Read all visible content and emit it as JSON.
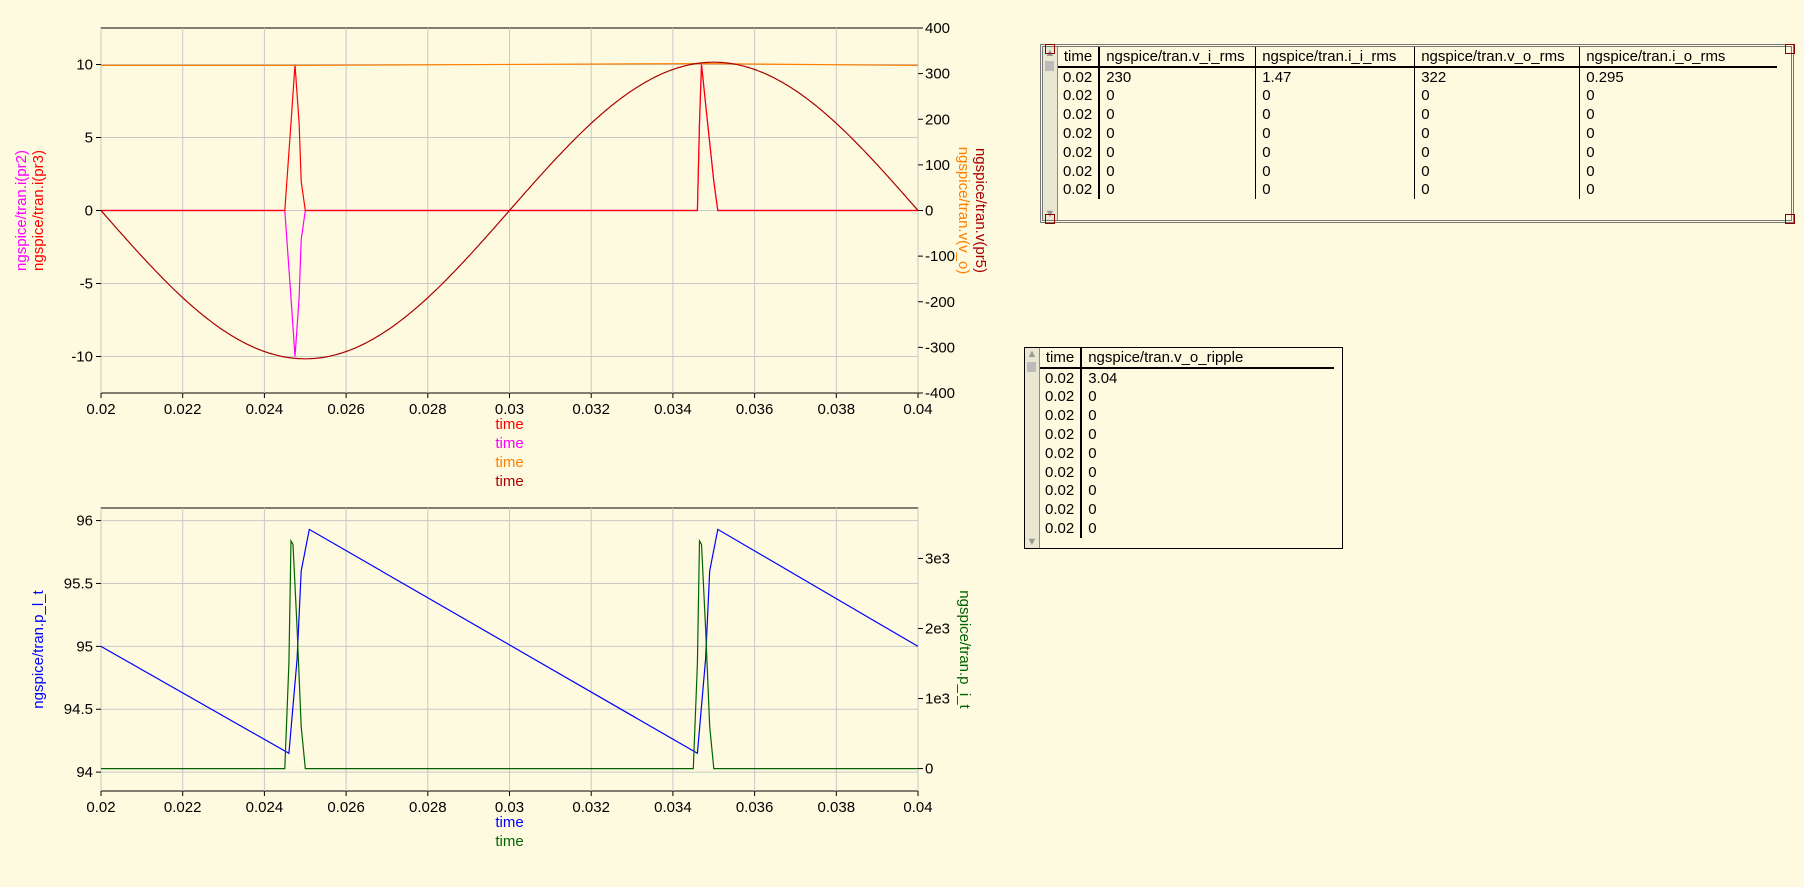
{
  "colors": {
    "background": "#fefae0",
    "grid": "#c8c8c8",
    "pr2": "#ff00ff",
    "pr3": "#ff0000",
    "v_o": "#ff7f00",
    "pr5": "#aa0000",
    "p_l_t": "#0000ff",
    "p_i_t": "#006400"
  },
  "chart_data": [
    {
      "type": "line",
      "xlabel_left_stack": [
        "time",
        "time",
        "time",
        "time"
      ],
      "xlim": [
        0.02,
        0.04
      ],
      "x_ticks": [
        "0.02",
        "0.022",
        "0.024",
        "0.026",
        "0.028",
        "0.03",
        "0.032",
        "0.034",
        "0.036",
        "0.038",
        "0.04"
      ],
      "grid": true,
      "left_axis": {
        "labels": [
          "ngspice/tran.i(pr2)",
          "ngspice/tran.i(pr3)"
        ],
        "ylim": [
          -12.5,
          12.5
        ],
        "ticks": [
          "-10",
          "-5",
          "0",
          "5",
          "10"
        ]
      },
      "right_axis": {
        "labels": [
          "ngspice/tran.v(pr5)",
          "ngspice/tran.v(v_o)"
        ],
        "ylim": [
          -400,
          400
        ],
        "ticks": [
          "-400",
          "-300",
          "-200",
          "-100",
          "0",
          "100",
          "200",
          "300",
          "400"
        ]
      },
      "series": [
        {
          "name": "ngspice/tran.i(pr2)",
          "axis": "left",
          "color": "#ff00ff",
          "x": [
            0.02,
            0.0245,
            0.02465,
            0.02475,
            0.02485,
            0.0249,
            0.025,
            0.0346,
            0.02,
            0.0346,
            0.03465,
            0.0347,
            0.03485,
            0.035,
            0.0351,
            0.04
          ],
          "y": [
            0,
            0,
            -6,
            -10,
            -6,
            -2,
            0,
            0,
            null,
            0,
            6,
            10,
            6,
            2,
            0,
            0
          ]
        },
        {
          "name": "ngspice/tran.i(pr3)",
          "axis": "left",
          "color": "#ff0000",
          "x": [
            0.02,
            0.0245,
            0.02465,
            0.02475,
            0.02485,
            0.0249,
            0.025,
            0.0346,
            0.03465,
            0.0347,
            0.03485,
            0.035,
            0.0351,
            0.04
          ],
          "y": [
            0,
            0,
            6,
            10,
            6,
            2,
            0,
            0,
            6,
            10,
            6,
            2,
            0,
            0
          ]
        },
        {
          "name": "ngspice/tran.v(v_o)",
          "axis": "right",
          "color": "#ff7f00",
          "x": [
            0.02,
            0.0247,
            0.0347,
            0.04
          ],
          "y": [
            318,
            318,
            322,
            318
          ]
        },
        {
          "name": "ngspice/tran.v(pr5)",
          "axis": "right",
          "color": "#aa0000",
          "function": "325*sin(2*pi*50*(x-0.03))"
        }
      ]
    },
    {
      "type": "line",
      "xlabel_left_stack": [
        "time",
        "time"
      ],
      "xlim": [
        0.02,
        0.04
      ],
      "x_ticks": [
        "0.02",
        "0.022",
        "0.024",
        "0.026",
        "0.028",
        "0.03",
        "0.032",
        "0.034",
        "0.036",
        "0.038",
        "0.04"
      ],
      "grid": true,
      "left_axis": {
        "labels": [
          "ngspice/tran.p_l_t"
        ],
        "ylim": [
          93.85,
          96.1
        ],
        "ticks": [
          "94",
          "94.5",
          "95",
          "95.5",
          "96"
        ]
      },
      "right_axis": {
        "labels": [
          "ngspice/tran.p_i_t"
        ],
        "ylim": [
          -320,
          3720
        ],
        "ticks": [
          "0",
          "1e3",
          "2e3",
          "3e3"
        ]
      },
      "series": [
        {
          "name": "ngspice/tran.p_l_t",
          "axis": "left",
          "color": "#0000ff",
          "x": [
            0.02,
            0.0246,
            0.0248,
            0.0249,
            0.0251,
            0.0346,
            0.0348,
            0.0349,
            0.0351,
            0.04
          ],
          "y": [
            95.0,
            94.15,
            94.9,
            95.6,
            95.93,
            94.15,
            94.9,
            95.6,
            95.93,
            95.0
          ]
        },
        {
          "name": "ngspice/tran.p_i_t",
          "axis": "right",
          "color": "#006400",
          "x": [
            0.02,
            0.0245,
            0.0246,
            0.02465,
            0.0247,
            0.0248,
            0.0249,
            0.025,
            0.0345,
            0.0346,
            0.03465,
            0.0347,
            0.0348,
            0.0349,
            0.035,
            0.04
          ],
          "y": [
            0,
            0,
            1500,
            3250,
            3200,
            2000,
            600,
            0,
            0,
            1500,
            3250,
            3200,
            2000,
            600,
            0,
            0
          ]
        }
      ]
    }
  ],
  "tables": {
    "rms": {
      "headers": [
        "time",
        "ngspice/tran.v_i_rms",
        "ngspice/tran.i_i_rms",
        "ngspice/tran.v_o_rms",
        "ngspice/tran.i_o_rms"
      ],
      "rows": [
        [
          "0.02",
          "230",
          "1.47",
          "322",
          "0.295"
        ],
        [
          "0.02",
          "0",
          "0",
          "0",
          "0"
        ],
        [
          "0.02",
          "0",
          "0",
          "0",
          "0"
        ],
        [
          "0.02",
          "0",
          "0",
          "0",
          "0"
        ],
        [
          "0.02",
          "0",
          "0",
          "0",
          "0"
        ],
        [
          "0.02",
          "0",
          "0",
          "0",
          "0"
        ],
        [
          "0.02",
          "0",
          "0",
          "0",
          "0"
        ]
      ]
    },
    "ripple": {
      "headers": [
        "time",
        "ngspice/tran.v_o_ripple"
      ],
      "rows": [
        [
          "0.02",
          "3.04"
        ],
        [
          "0.02",
          "0"
        ],
        [
          "0.02",
          "0"
        ],
        [
          "0.02",
          "0"
        ],
        [
          "0.02",
          "0"
        ],
        [
          "0.02",
          "0"
        ],
        [
          "0.02",
          "0"
        ],
        [
          "0.02",
          "0"
        ],
        [
          "0.02",
          "0"
        ]
      ]
    }
  }
}
